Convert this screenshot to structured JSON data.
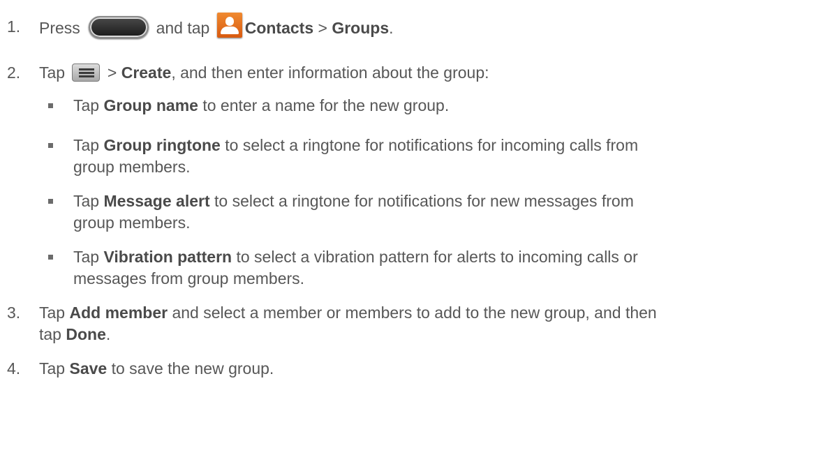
{
  "steps": [
    {
      "number": "1.",
      "before": "Press ",
      "middle": " and tap ",
      "bold1": "Contacts",
      "sep": " > ",
      "bold2": "Groups",
      "end": "."
    },
    {
      "number": "2.",
      "before": "Tap ",
      "sep": " > ",
      "bold1": "Create",
      "after": ", and then enter information about the group:"
    },
    {
      "number": "3.",
      "line1_before": "Tap ",
      "bold1": "Add member",
      "line1_after": " and select a member or members to add to the new group, and then",
      "line2_before": "tap ",
      "bold2": "Done",
      "line2_after": "."
    },
    {
      "number": "4.",
      "before": "Tap ",
      "bold1": "Save",
      "after": " to save the new group."
    }
  ],
  "substeps": [
    {
      "before": "Tap ",
      "bold": "Group name",
      "after": " to enter a name for the new group.",
      "cont": ""
    },
    {
      "before": "Tap ",
      "bold": "Group ringtone",
      "after": " to select a ringtone for notifications for incoming calls from",
      "cont": "group members."
    },
    {
      "before": "Tap ",
      "bold": "Message alert",
      "after": " to select a ringtone for notifications for new messages from",
      "cont": "group members."
    },
    {
      "before": "Tap ",
      "bold": "Vibration pattern",
      "after": " to select a vibration pattern for alerts to incoming calls or",
      "cont": "messages from group members."
    }
  ],
  "icons": {
    "home_key": "home-key-icon",
    "contacts": "contacts-icon",
    "menu": "menu-key-icon",
    "contacts_color": "#e8782a"
  }
}
